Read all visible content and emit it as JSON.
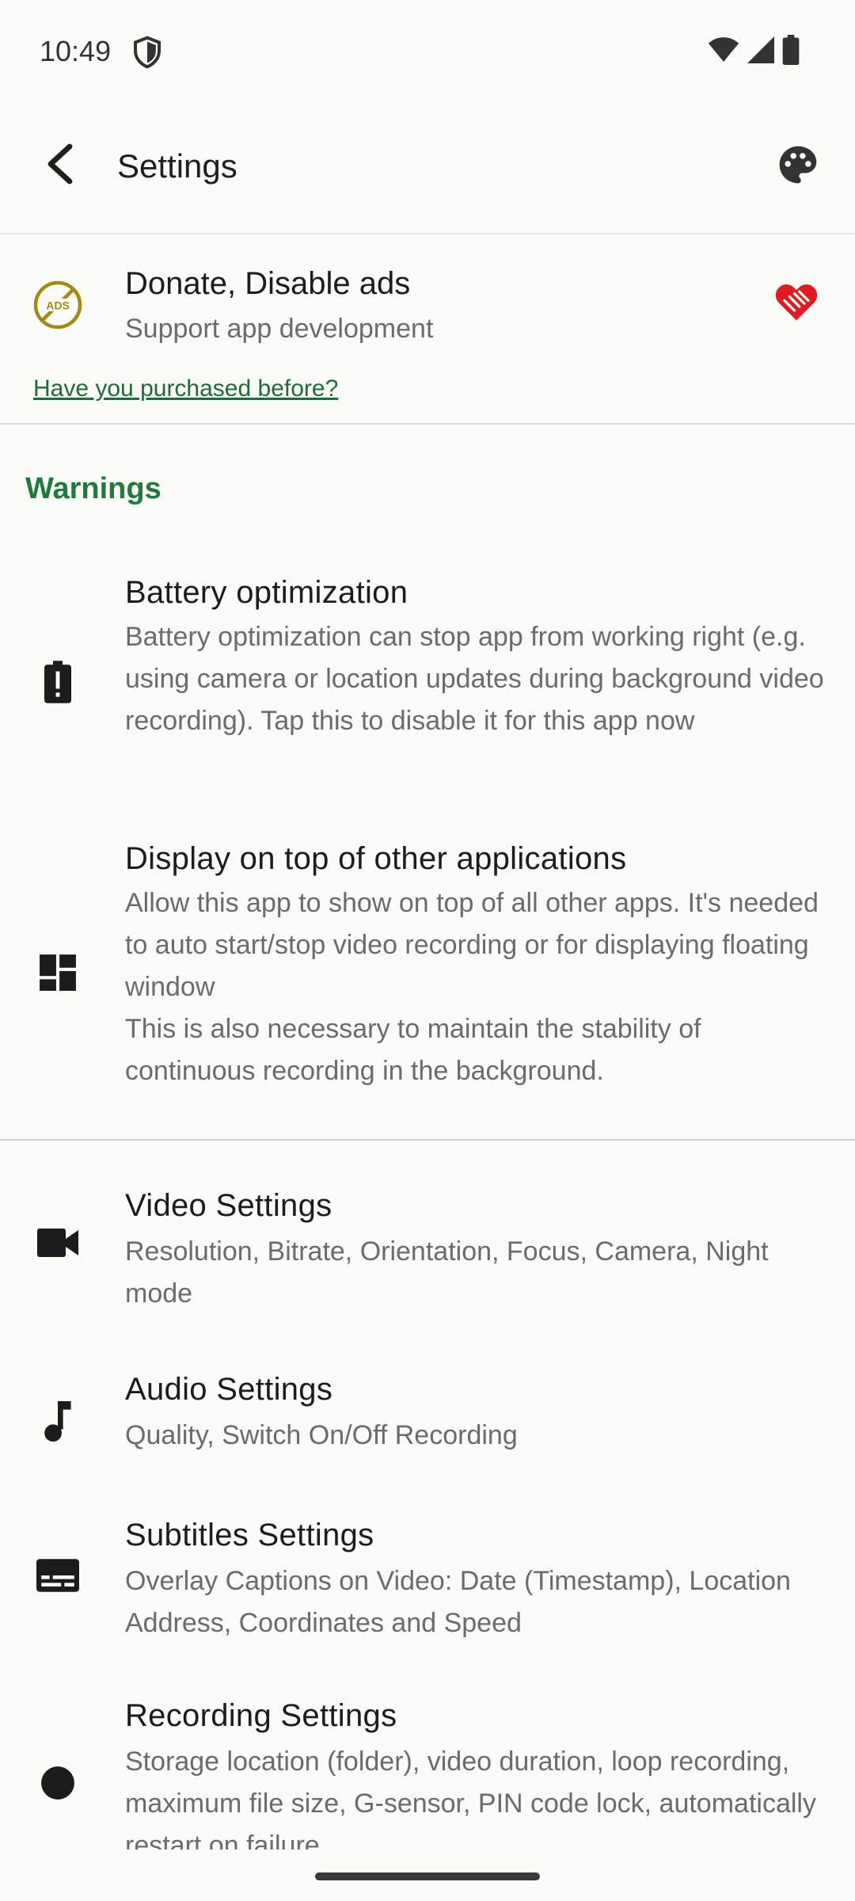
{
  "status_bar": {
    "time": "10:49"
  },
  "app_bar": {
    "title": "Settings"
  },
  "donate": {
    "title": "Donate, Disable ads",
    "subtitle": "Support app development",
    "ads_badge": "ADS",
    "link": "Have you purchased before?"
  },
  "warnings": {
    "header": "Warnings",
    "items": [
      {
        "title": "Battery optimization",
        "subtitle": "Battery optimization can stop app from working right (e.g. using camera or location updates during background video recording). Tap this to disable it for this app now",
        "icon": "battery-alert-icon"
      },
      {
        "title": "Display on top of other applications",
        "subtitle": "Allow this app to show on top of all other apps. It's needed to auto start/stop video recording or for displaying floating window\nThis is also necessary to maintain the stability of continuous recording in the background.",
        "icon": "dashboard-icon"
      }
    ]
  },
  "settings": {
    "items": [
      {
        "title": "Video Settings",
        "subtitle": "Resolution, Bitrate, Orientation, Focus, Camera, Night mode",
        "icon": "videocam-icon"
      },
      {
        "title": "Audio Settings",
        "subtitle": "Quality, Switch On/Off Recording",
        "icon": "music-note-icon"
      },
      {
        "title": "Subtitles Settings",
        "subtitle": "Overlay Captions on Video: Date (Timestamp), Location Address, Coordinates and Speed",
        "icon": "subtitles-icon"
      },
      {
        "title": "Recording Settings",
        "subtitle": "Storage location (folder), video duration, loop recording, maximum file size, G-sensor, PIN code lock, automatically restart on failure",
        "icon": "record-dot-icon"
      }
    ]
  },
  "colors": {
    "accent_green": "#1f7a3c",
    "link_green": "#1c6b3a",
    "heart_red": "#e2191e",
    "ads_gold": "#a38a12"
  }
}
